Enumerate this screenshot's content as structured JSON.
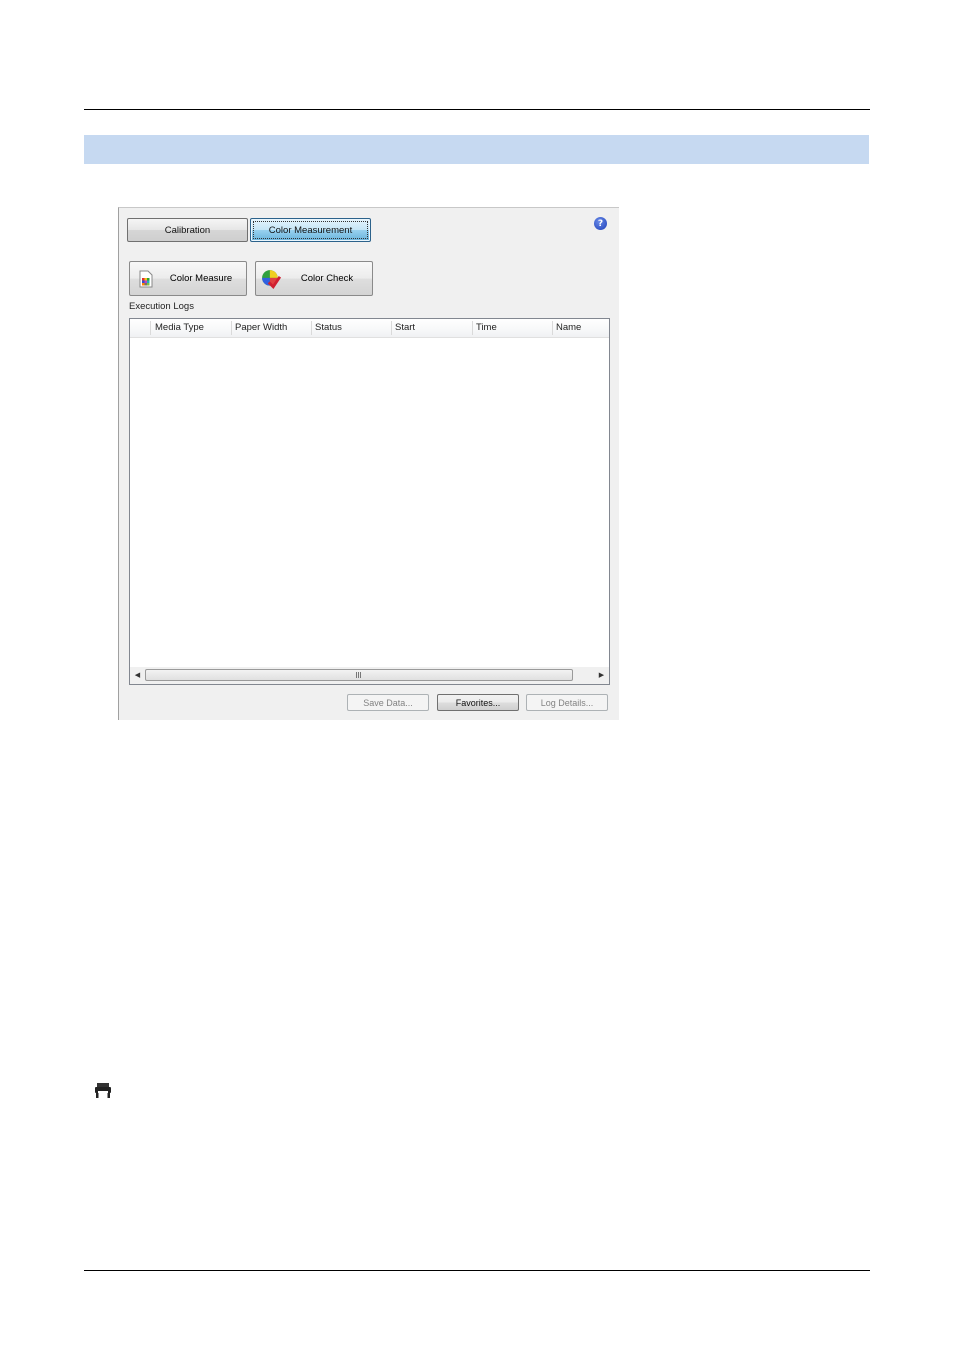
{
  "tabs": [
    {
      "label": "Calibration",
      "selected": false
    },
    {
      "label": "Color Measurement",
      "selected": true
    }
  ],
  "actions": {
    "color_measure_label": "Color Measure",
    "color_check_label": "Color Check"
  },
  "logs": {
    "section_label": "Execution Logs",
    "columns": [
      "Media Type",
      "Paper Width",
      "Status",
      "Start",
      "Time",
      "Name"
    ],
    "rows": []
  },
  "scrollbar_grip": "III",
  "footer_buttons": {
    "save_label": "Save Data...",
    "favorites_label": "Favorites...",
    "log_details_label": "Log Details..."
  },
  "colors": {
    "section_bar": "#c6d9f1",
    "selected_tab": "#98d1ef"
  },
  "icons": {
    "help": "help-icon",
    "color_measure": "color-chart-icon",
    "color_check": "color-wheel-check-icon",
    "printer": "printer-icon"
  }
}
